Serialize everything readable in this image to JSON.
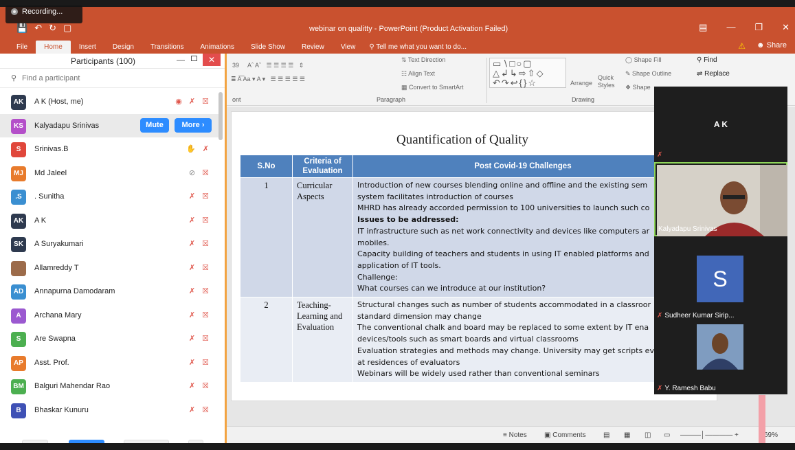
{
  "window": {
    "title": "webinar on qualitty - PowerPoint (Product Activation Failed)",
    "recording_label": "Recording...",
    "share_label": "Share",
    "warning_icon": "warning-icon"
  },
  "ribbon_tabs": [
    "File",
    "Home",
    "Insert",
    "Design",
    "Transitions",
    "Animations",
    "Slide Show",
    "Review",
    "View"
  ],
  "tell_me": "Tell me what you want to do...",
  "ribbon": {
    "font_size": "39",
    "font_group_label": "ont",
    "paragraph_label": "Paragraph",
    "drawing_label": "Drawing",
    "text_direction": "Text Direction",
    "align_text": "Align Text",
    "convert_smartart": "Convert to SmartArt",
    "arrange": "Arrange",
    "quick_styles": "Quick Styles",
    "shape_fill": "Shape Fill",
    "shape_outline": "Shape Outline",
    "shape_effects": "Shape",
    "find": "Find",
    "replace": "Replace"
  },
  "slide": {
    "title": "Quantification of Quality",
    "headers": [
      "S.No",
      "Criteria of Evaluation",
      "Post Covid-19 Challenges"
    ],
    "rows": [
      {
        "sno": "1",
        "criteria": "Curricular Aspects",
        "lines": [
          {
            "text": "Introduction of new courses blending online and offline and the existing sem",
            "bold": false
          },
          {
            "text": "system facilitates introduction of courses",
            "bold": false
          },
          {
            "text": "MHRD has already accorded permission to 100 universities to launch such co",
            "bold": false
          },
          {
            "text": "Issues to be addressed:",
            "bold": true
          },
          {
            "text": "IT infrastructure such as net work connectivity and devices like computers ar",
            "bold": false
          },
          {
            "text": "mobiles.",
            "bold": false
          },
          {
            "text": "Capacity building of teachers and students in using IT enabled platforms and",
            "bold": false
          },
          {
            "text": "application of IT tools.",
            "bold": false
          },
          {
            "text": "Challenge:",
            "bold": false
          },
          {
            "text": "What courses can we introduce at our institution?",
            "bold": false
          }
        ]
      },
      {
        "sno": "2",
        "criteria": "Teaching-Learning and Evaluation",
        "lines": [
          {
            "text": "Structural changes such as number of students accommodated in a classroor",
            "bold": false
          },
          {
            "text": "standard dimension may change",
            "bold": false
          },
          {
            "text": "The conventional chalk and board may be replaced to some extent by IT ena",
            "bold": false
          },
          {
            "text": "devices/tools such as smart boards and virtual classrooms",
            "bold": false
          },
          {
            "text": "Evaluation strategies and methods may change. University may get scripts ev",
            "bold": false
          },
          {
            "text": "at  residences of evaluators",
            "bold": false
          },
          {
            "text": "Webinars will be widely used rather than conventional seminars",
            "bold": false
          }
        ]
      }
    ]
  },
  "statusbar": {
    "notes": "Notes",
    "comments": "Comments",
    "zoom": "69%"
  },
  "participants": {
    "title": "Participants (100)",
    "search_placeholder": "Find a participant",
    "mute_label": "Mute",
    "more_label": "More",
    "list": [
      {
        "initials": "AK",
        "name": "A K (Host, me)",
        "color": "#2e3a4f",
        "rec": true
      },
      {
        "initials": "KS",
        "name": "Kalyadapu Srinivas",
        "color": "#b44fc9",
        "hover": true
      },
      {
        "initials": "S",
        "name": "Srinivas.B",
        "color": "#e0473b",
        "hand": true
      },
      {
        "initials": "MJ",
        "name": "Md Jaleel",
        "color": "#e87b2c",
        "grey_mic": true
      },
      {
        "initials": ".S",
        "name": ". Sunitha",
        "color": "#3a8fd1"
      },
      {
        "initials": "AK",
        "name": "A K",
        "color": "#2e3a4f"
      },
      {
        "initials": "SK",
        "name": "A Suryakumari",
        "color": "#2e3a4f"
      },
      {
        "initials": "",
        "name": "Allamreddy T",
        "color": "#9c6b4a",
        "photo": true
      },
      {
        "initials": "AD",
        "name": "Annapurna Damodaram",
        "color": "#3a8fd1"
      },
      {
        "initials": "A",
        "name": "Archana Mary",
        "color": "#9b59d0"
      },
      {
        "initials": "S",
        "name": "Are Swapna",
        "color": "#4caf50"
      },
      {
        "initials": "AP",
        "name": "Asst. Prof.",
        "color": "#e87b2c"
      },
      {
        "initials": "BM",
        "name": "Balguri Mahendar Rao",
        "color": "#4caf50"
      },
      {
        "initials": "B",
        "name": "Bhaskar Kunuru",
        "color": "#3f51b5"
      }
    ],
    "footer": {
      "invite": "Invite",
      "mute_all": "Mute All",
      "unmute_all": "Unmute All",
      "more": "..."
    }
  },
  "gallery": {
    "speaker_name": "A K",
    "tiles": [
      {
        "name": "Kalyadapu Srinivas"
      },
      {
        "name": "Sudheer Kumar Sirip...",
        "letter": "S"
      },
      {
        "name": "Y. Ramesh Babu"
      }
    ]
  }
}
